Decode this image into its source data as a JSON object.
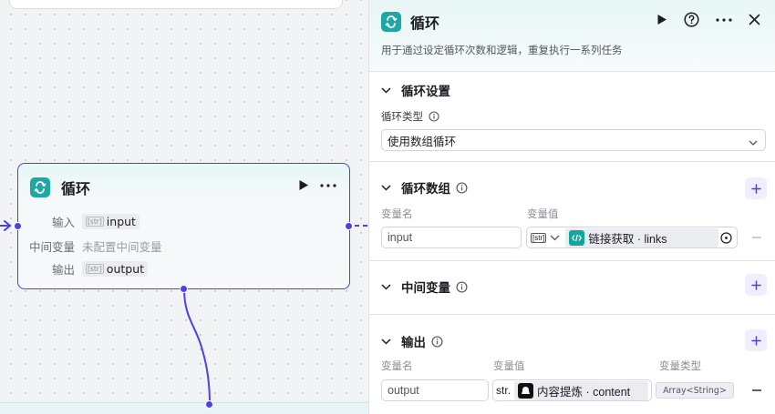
{
  "canvas": {
    "node": {
      "title": "循环",
      "rows": [
        {
          "label": "输入",
          "tag": "[str]",
          "value": "input"
        },
        {
          "label": "中间变量",
          "value": "未配置中间变量"
        },
        {
          "label": "输出",
          "tag": "[str]",
          "value": "output"
        }
      ]
    }
  },
  "panel": {
    "title": "循环",
    "description": "用于通过设定循环次数和逻辑，重复执行一系列任务",
    "loop_settings": {
      "title": "循环设置",
      "type_label": "循环类型",
      "type_value": "使用数组循环"
    },
    "loop_array": {
      "title": "循环数组",
      "col_name": "变量名",
      "col_value": "变量值",
      "row": {
        "name": "input",
        "type_tag": "[str]",
        "ref_text": "链接获取 · links"
      }
    },
    "intermediate": {
      "title": "中间变量"
    },
    "output": {
      "title": "输出",
      "col_name": "变量名",
      "col_value": "变量值",
      "col_type": "变量类型",
      "row": {
        "name": "output",
        "type_tag": "str.",
        "ref_text": "内容提炼 · content",
        "var_type": "Array<String>"
      }
    }
  },
  "colors": {
    "accent": "#4e40e5",
    "loop_icon": "#1fa7a3",
    "link_app_icon": "#12a6a0",
    "content_app_icon": "#111111"
  },
  "icons": {
    "loop": "loop-icon",
    "run": "play-icon",
    "help": "question-icon",
    "more": "more-icon",
    "close": "close-icon",
    "collapse": "chevron-down-icon",
    "info": "info-icon",
    "add": "plus-icon",
    "remove": "minus-icon",
    "clear": "clear-icon"
  }
}
